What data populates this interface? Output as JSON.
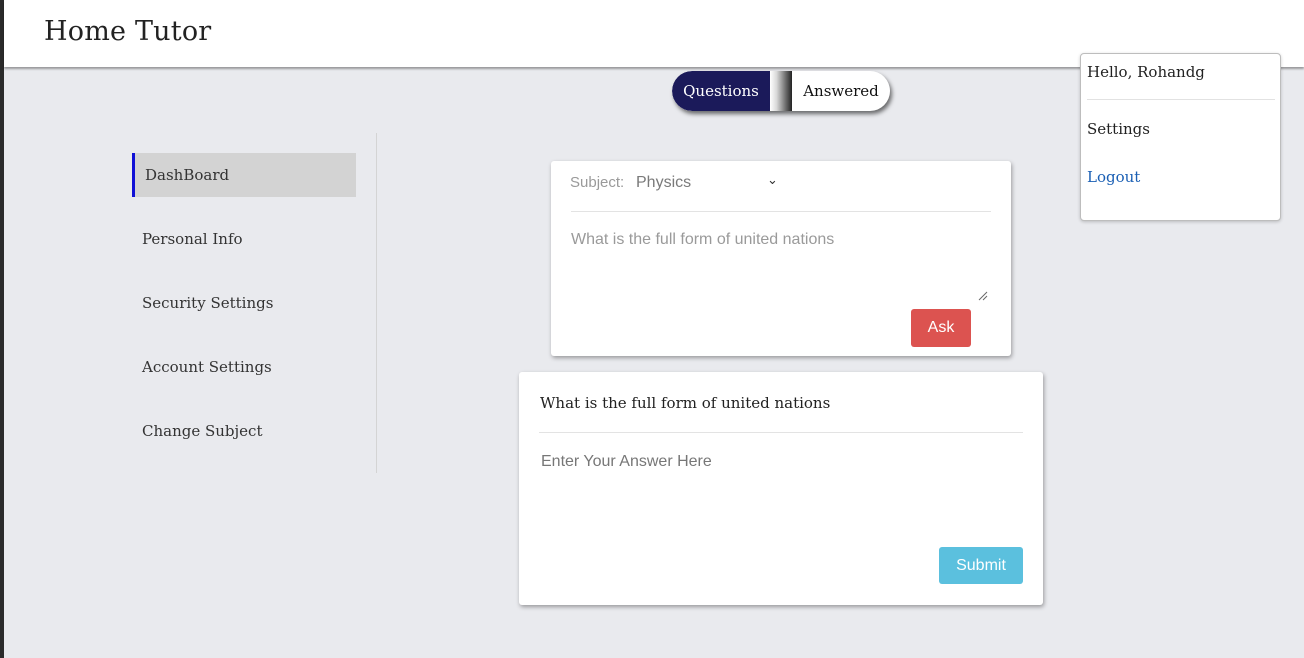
{
  "header": {
    "brand": "Home Tutor"
  },
  "user_menu": {
    "greeting": "Hello, Rohandg",
    "settings_label": "Settings",
    "logout_label": "Logout"
  },
  "toggle": {
    "questions_label": "Questions",
    "answered_label": "Answered",
    "active": "Questions"
  },
  "sidebar": {
    "items": [
      {
        "label": "DashBoard",
        "active": true
      },
      {
        "label": "Personal Info",
        "active": false
      },
      {
        "label": "Security Settings",
        "active": false
      },
      {
        "label": "Account Settings",
        "active": false
      },
      {
        "label": "Change Subject",
        "active": false
      }
    ]
  },
  "ask_form": {
    "subject_label": "Subject:",
    "subject_value": "Physics",
    "question_text": "What is the full form of united nations",
    "ask_label": "Ask"
  },
  "answer_form": {
    "question_text": "What is the full form of united nations",
    "answer_placeholder": "Enter Your Answer Here",
    "submit_label": "Submit"
  },
  "colors": {
    "toggle_active": "#1b1a5a",
    "ask_button": "#dc5350",
    "submit_button": "#5bc0de",
    "sidebar_active_marker": "#1010d6",
    "logout_link": "#1a5fb4"
  },
  "icons": {
    "avatar": "user-avatar",
    "subject_dropdown": "chevron-down-icon",
    "textarea_resize": "resize-handle-icon"
  }
}
